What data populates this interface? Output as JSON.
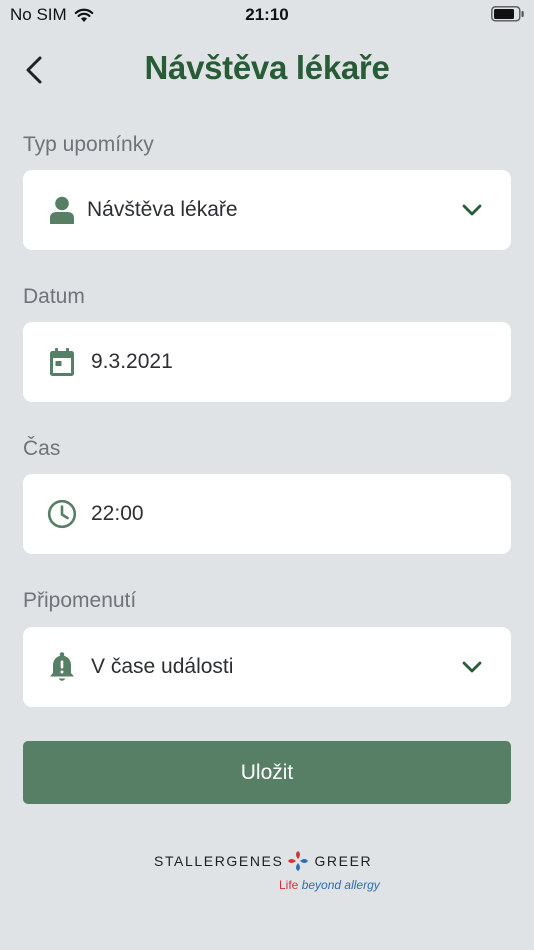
{
  "status_bar": {
    "carrier": "No SIM",
    "time": "21:10"
  },
  "header": {
    "title": "Návštěva lékaře"
  },
  "form": {
    "reminder_type": {
      "label": "Typ upomínky",
      "value": "Návštěva lékaře",
      "icon": "person-icon"
    },
    "date": {
      "label": "Datum",
      "value": "9.3.2021",
      "icon": "calendar-icon"
    },
    "time": {
      "label": "Čas",
      "value": "22:00",
      "icon": "clock-icon"
    },
    "reminder": {
      "label": "Připomenutí",
      "value": "V čase události",
      "icon": "bell-alert-icon"
    },
    "save_label": "Uložit"
  },
  "brand": {
    "left": "STALLERGENES",
    "right": "GREER",
    "tagline_life": "Life",
    "tagline_rest": "beyond allergy"
  },
  "colors": {
    "accent": "#567f66",
    "title": "#275c37",
    "background": "#dfe3e5"
  }
}
